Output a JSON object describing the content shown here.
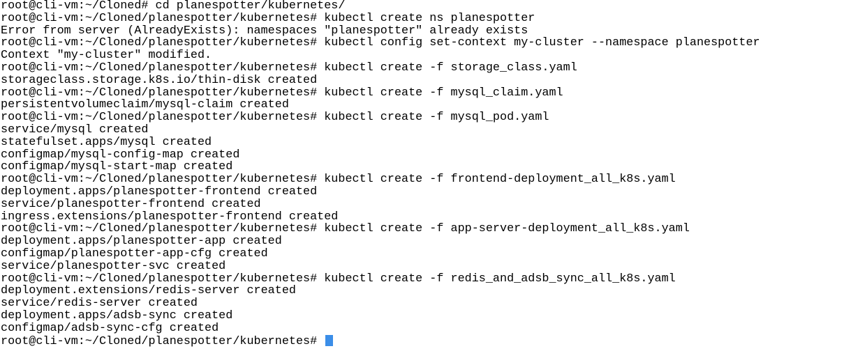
{
  "terminal": {
    "colors": {
      "background": "#ffffff",
      "text": "#000000",
      "cursor": "#3b8ee8"
    },
    "lines": [
      "root@cli-vm:~/Cloned# cd planespotter/kubernetes/",
      "root@cli-vm:~/Cloned/planespotter/kubernetes# kubectl create ns planespotter",
      "Error from server (AlreadyExists): namespaces \"planespotter\" already exists",
      "root@cli-vm:~/Cloned/planespotter/kubernetes# kubectl config set-context my-cluster --namespace planespotter",
      "Context \"my-cluster\" modified.",
      "root@cli-vm:~/Cloned/planespotter/kubernetes# kubectl create -f storage_class.yaml",
      "storageclass.storage.k8s.io/thin-disk created",
      "root@cli-vm:~/Cloned/planespotter/kubernetes# kubectl create -f mysql_claim.yaml",
      "persistentvolumeclaim/mysql-claim created",
      "root@cli-vm:~/Cloned/planespotter/kubernetes# kubectl create -f mysql_pod.yaml",
      "service/mysql created",
      "statefulset.apps/mysql created",
      "configmap/mysql-config-map created",
      "configmap/mysql-start-map created",
      "root@cli-vm:~/Cloned/planespotter/kubernetes# kubectl create -f frontend-deployment_all_k8s.yaml",
      "deployment.apps/planespotter-frontend created",
      "service/planespotter-frontend created",
      "ingress.extensions/planespotter-frontend created",
      "root@cli-vm:~/Cloned/planespotter/kubernetes# kubectl create -f app-server-deployment_all_k8s.yaml",
      "deployment.apps/planespotter-app created",
      "configmap/planespotter-app-cfg created",
      "service/planespotter-svc created",
      "root@cli-vm:~/Cloned/planespotter/kubernetes# kubectl create -f redis_and_adsb_sync_all_k8s.yaml",
      "deployment.extensions/redis-server created",
      "service/redis-server created",
      "deployment.apps/adsb-sync created",
      "configmap/adsb-sync-cfg created"
    ],
    "prompt": "root@cli-vm:~/Cloned/planespotter/kubernetes# "
  }
}
